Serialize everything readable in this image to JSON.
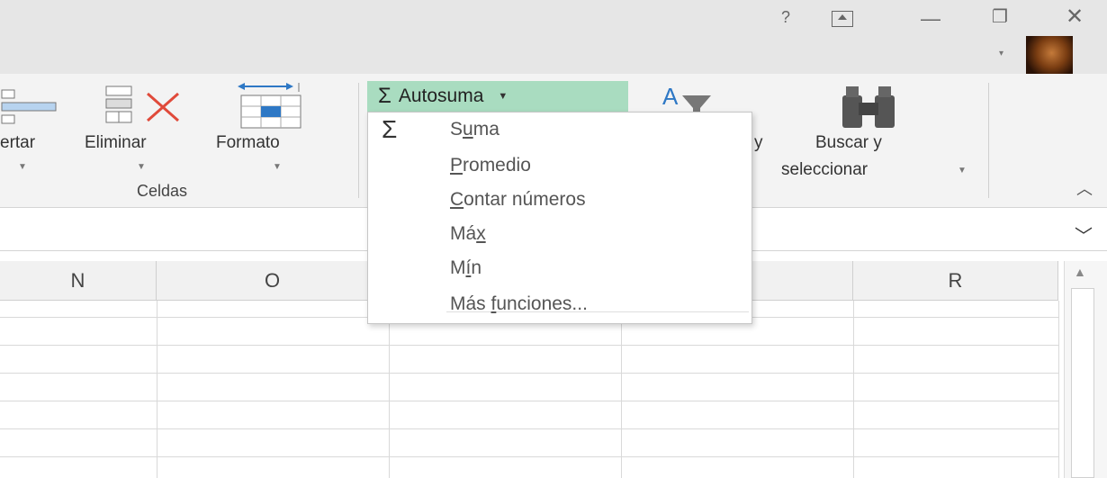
{
  "titlebar": {
    "help_glyph": "?",
    "restore_ribbon_glyph": "⇱",
    "minimize_glyph": "—",
    "maximize_glyph": "❐",
    "close_glyph": "✕",
    "account_dropdown_glyph": "▾"
  },
  "ribbon": {
    "cells_group": {
      "insert_label": "ertar",
      "delete_label": "Eliminar",
      "format_label": "Formato",
      "group_label": "Celdas"
    },
    "editing_group": {
      "autosum_label": "Autosuma",
      "sort_partial_label": "y",
      "find_label_line1": "Buscar y",
      "find_label_line2": "seleccionar"
    },
    "collapse_glyph": "︿"
  },
  "formula_bar": {
    "expand_glyph": "﹀"
  },
  "grid": {
    "column_headers": [
      "N",
      "O",
      "",
      "",
      "R"
    ]
  },
  "autosum_menu": {
    "sigma_glyph": "Σ",
    "items": [
      {
        "pre": "S",
        "key": "u",
        "post": "ma"
      },
      {
        "pre": "",
        "key": "P",
        "post": "romedio"
      },
      {
        "pre": "",
        "key": "C",
        "post": "ontar números"
      },
      {
        "pre": "Má",
        "key": "x",
        "post": ""
      },
      {
        "pre": "M",
        "key": "í",
        "post": "n"
      },
      {
        "pre": "Más ",
        "key": "f",
        "post": "unciones..."
      }
    ]
  },
  "colors": {
    "autosum_highlight": "#a9dcc0",
    "ribbon_bg": "#f3f3f3",
    "titlebar_bg": "#e6e6e6",
    "delete_icon_red": "#e04a3a",
    "format_icon_blue": "#2e78c5"
  }
}
